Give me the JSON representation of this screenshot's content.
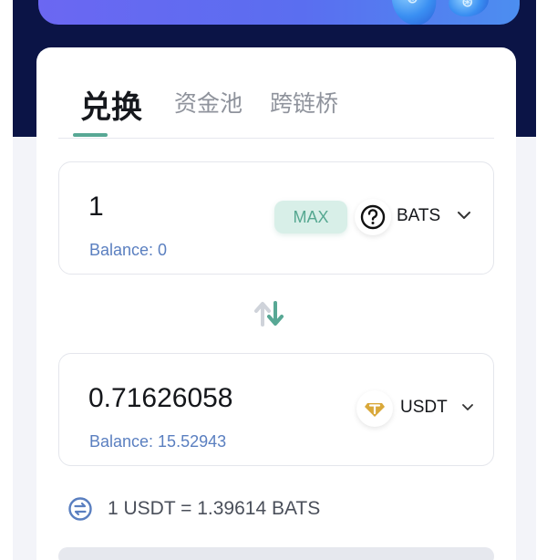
{
  "colors": {
    "header_bg": "#0b1446",
    "page_bg": "#f3f4f9",
    "accent": "#58a895",
    "max_bg": "#d8efe8",
    "balance": "#5a7fc0"
  },
  "tabs": [
    {
      "label": "兑换",
      "active": true
    },
    {
      "label": "资金池",
      "active": false
    },
    {
      "label": "跨链桥",
      "active": false
    }
  ],
  "from": {
    "amount": "1",
    "balance": "Balance: 0",
    "max_label": "MAX",
    "token": "BATS",
    "token_icon": "question-circle-icon"
  },
  "swap_icon": "swap-arrows-icon",
  "to": {
    "amount": "0.71626058",
    "balance": "Balance: 15.52943",
    "token": "USDT",
    "token_icon": "tether-icon"
  },
  "rate": {
    "text": "1 USDT = 1.39614 BATS",
    "icon": "exchange-rate-icon"
  }
}
